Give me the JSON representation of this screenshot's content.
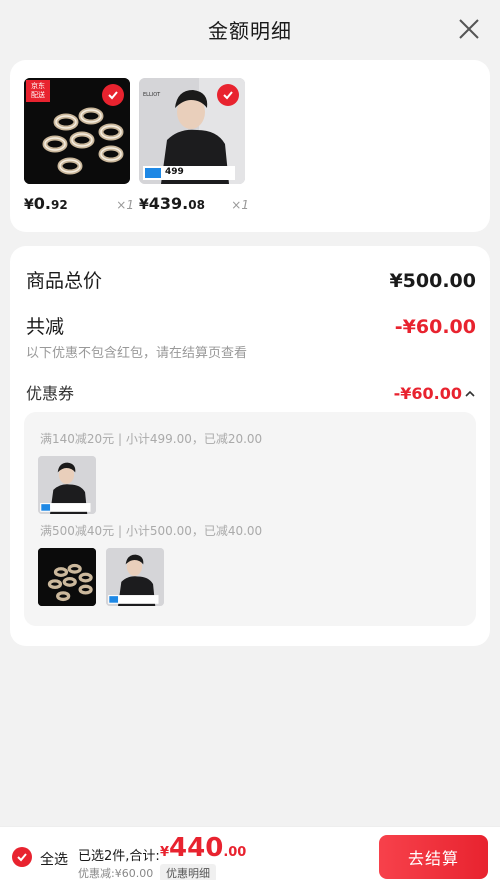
{
  "header": {
    "title": "金额明细"
  },
  "products": [
    {
      "badge": "京东\n配送",
      "price_yen": "¥",
      "price_int": "0.",
      "price_dec": "92",
      "qty": "×1"
    },
    {
      "price_yen": "¥",
      "price_int": "439.",
      "price_dec": "08",
      "qty": "×1",
      "poster_brand": "ELLIOT",
      "poster_price": "499"
    }
  ],
  "summary": {
    "total_label": "商品总价",
    "total_amount": "¥500.00",
    "discount_label": "共减",
    "discount_amount": "-¥60.00",
    "note": "以下优惠不包含红包，请在结算页查看",
    "coupon_label": "优惠券",
    "coupon_amount": "-¥60.00"
  },
  "coupons": [
    {
      "text": "满140减20元 | 小计499.00，已减20.00"
    },
    {
      "text": "满500减40元 | 小计500.00，已减40.00"
    }
  ],
  "footer": {
    "select_all": "全选",
    "selected_text": "已选2件,合计:",
    "total_yen": "¥",
    "total_int": "440",
    "total_dec": ".00",
    "discount_text": "优惠减:¥60.00",
    "detail_tag": "优惠明细",
    "checkout": "去结算"
  },
  "colors": {
    "accent": "#e8232f"
  }
}
